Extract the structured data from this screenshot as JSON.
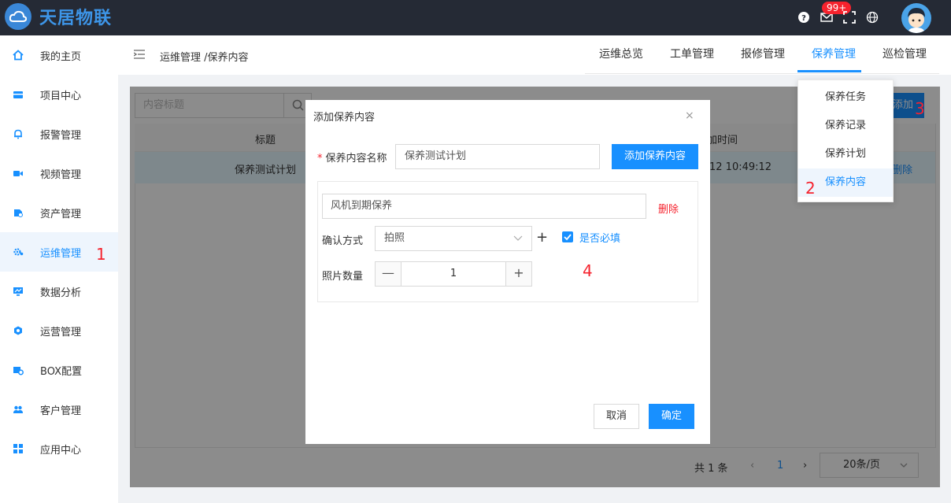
{
  "app": {
    "logo_text": "天居物联",
    "notification_badge": "99+"
  },
  "sidebar": {
    "items": [
      {
        "label": "我的主页",
        "icon": "home-icon"
      },
      {
        "label": "项目中心",
        "icon": "project-icon"
      },
      {
        "label": "报警管理",
        "icon": "bell-icon"
      },
      {
        "label": "视频管理",
        "icon": "video-icon"
      },
      {
        "label": "资产管理",
        "icon": "asset-icon"
      },
      {
        "label": "运维管理",
        "icon": "gear-icon",
        "active": true
      },
      {
        "label": "数据分析",
        "icon": "monitor-icon"
      },
      {
        "label": "运营管理",
        "icon": "operation-icon"
      },
      {
        "label": "BOX配置",
        "icon": "box-icon"
      },
      {
        "label": "客户管理",
        "icon": "users-icon"
      },
      {
        "label": "应用中心",
        "icon": "apps-icon"
      }
    ]
  },
  "header": {
    "breadcrumb": "运维管理 /保养内容",
    "tabs": [
      "运维总览",
      "工单管理",
      "报修管理",
      "保养管理",
      "巡检管理"
    ],
    "active_tab": "保养管理"
  },
  "dropdown": {
    "items": [
      "保养任务",
      "保养记录",
      "保养计划",
      "保养内容"
    ],
    "active": "保养内容"
  },
  "page": {
    "search_placeholder": "内容标题",
    "add_button": "添加",
    "columns": {
      "title": "标题",
      "time": "加时间"
    },
    "row": {
      "title": "保养测试计划",
      "time": "12 10:49:12",
      "delete": "删除"
    },
    "pagination": {
      "total": "共 1 条",
      "current": "1",
      "page_size": "20条/页"
    }
  },
  "modal": {
    "title": "添加保养内容",
    "name_label": "保养内容名称",
    "name_value": "保养测试计划",
    "add_content_button": "添加保养内容",
    "item": {
      "name": "风机到期保养",
      "delete": "删除",
      "confirm_label": "确认方式",
      "confirm_value": "拍照",
      "plus": "+",
      "required_label": "是否必填",
      "photo_label": "照片数量",
      "photo_count": "1",
      "minus_glyph": "—",
      "plus_glyph": "+"
    },
    "cancel": "取消",
    "ok": "确定"
  },
  "annotations": {
    "n1": "1",
    "n2": "2",
    "n3": "3",
    "n4": "4"
  },
  "colors": {
    "primary": "#1890ff",
    "danger": "#f5222d",
    "topbar": "#252a35"
  }
}
